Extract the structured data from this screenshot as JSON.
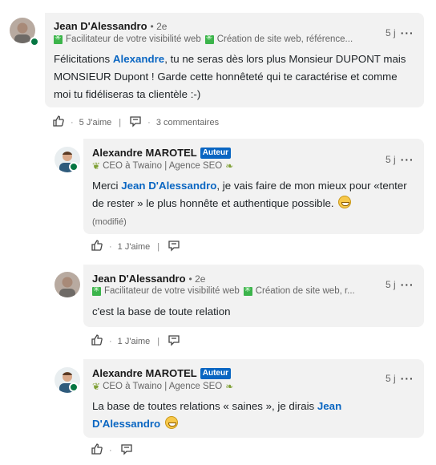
{
  "comments": [
    {
      "author": "Jean D'Alessandro",
      "degree": "• 2e",
      "headline": [
        "Facilitateur de votre visibilité web",
        "Création de site web, référence..."
      ],
      "time": "5 j",
      "text_before": "Félicitations ",
      "mention": "Alexandre",
      "text_after": ", tu ne seras dès lors plus Monsieur DUPONT mais MONSIEUR Dupont ! Garde cette honnêteté qui te caractérise et comme moi tu fidéliseras ta clientèle :-)",
      "likes": "5 J'aime",
      "replies": "3 commentaires"
    },
    {
      "author": "Alexandre MAROTEL",
      "badge": "Auteur",
      "headline": "CEO à Twaino | Agence SEO",
      "time": "5 j",
      "text_before": "Merci ",
      "mention": "Jean D'Alessandro",
      "text_after": ", je vais faire de mon mieux pour «tenter de rester » le plus honnête et authentique possible.",
      "modified": "(modifié)",
      "likes": "1 J'aime"
    },
    {
      "author": "Jean D'Alessandro",
      "degree": "• 2e",
      "headline": [
        "Facilitateur de votre visibilité web",
        "Création de site web, r..."
      ],
      "time": "5 j",
      "text": "c'est la base de toute relation",
      "likes": "1 J'aime"
    },
    {
      "author": "Alexandre MAROTEL",
      "badge": "Auteur",
      "headline": "CEO à Twaino | Agence SEO",
      "time": "5 j",
      "text_before": "La base de toutes relations « saines », je dirais ",
      "mention": "Jean D'Alessandro"
    }
  ],
  "colors": {
    "accent": "#0a66c2",
    "bubble": "#f2f2f2",
    "online": "#057642"
  }
}
